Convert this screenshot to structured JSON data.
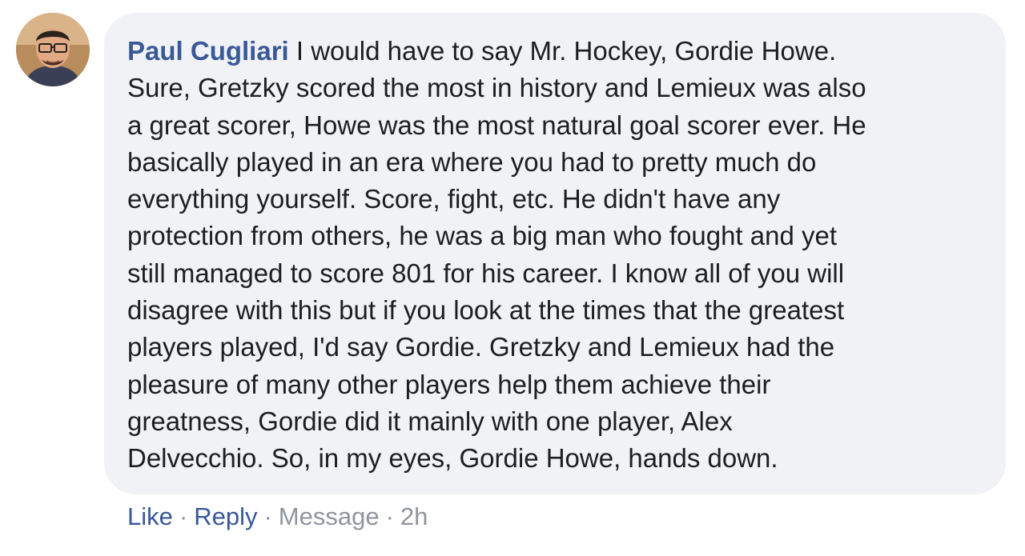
{
  "comment": {
    "author": "Paul Cugliari",
    "text_lines": [
      "I would have to say Mr. Hockey, Gordie Howe.",
      "Sure, Gretzky scored the most in history and Lemieux was also",
      "a great scorer, Howe was the most natural goal scorer ever. He",
      "basically played in an era where you had to pretty much do",
      "everything yourself. Score, fight, etc. He didn't have any",
      "protection from others, he was a big man who fought and yet",
      "still managed to score 801 for his career. I know all of you will",
      "disagree with this but if you look at the times that the greatest",
      "players played, I'd say Gordie. Gretzky and Lemieux had the",
      "pleasure of many other players help them achieve their",
      "greatness, Gordie did it mainly with one player, Alex",
      "Delvecchio. So, in my eyes, Gordie Howe, hands down."
    ],
    "actions": {
      "like": "Like",
      "reply": "Reply",
      "message": "Message",
      "time": "2h",
      "separator": "·"
    }
  },
  "colors": {
    "bubble": "#f1f2f5",
    "author": "#385898",
    "text": "#1c1e21",
    "link": "#385898",
    "muted": "#90949c"
  },
  "icons": {
    "avatar": "user-avatar-photo"
  }
}
